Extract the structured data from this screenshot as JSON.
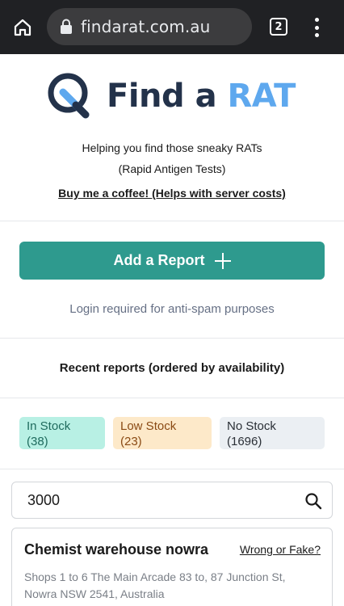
{
  "browser": {
    "url": "findarat.com.au",
    "tab_count": "2"
  },
  "header": {
    "logo_find": "Find a ",
    "logo_rat": "RAT",
    "tagline_1": "Helping you find those sneaky RATs",
    "tagline_2": "(Rapid Antigen Tests)",
    "coffee_link": "Buy me a coffee! (Helps with server costs)"
  },
  "actions": {
    "add_report_label": "Add a Report",
    "login_note": "Login required for anti-spam purposes"
  },
  "recent": {
    "title": "Recent reports (ordered by availability)",
    "badges": [
      {
        "label": "In Stock",
        "count": "(38)"
      },
      {
        "label": "Low Stock",
        "count": "(23)"
      },
      {
        "label": "No Stock",
        "count": "(1696)"
      }
    ]
  },
  "search": {
    "value": "3000"
  },
  "results": [
    {
      "name": "Chemist warehouse nowra",
      "flag_link": "Wrong or Fake?",
      "address_line_1": "Shops 1 to 6 The Main Arcade 83 to, 87 Junction St,",
      "address_line_2": "Nowra NSW 2541, Australia"
    }
  ],
  "colors": {
    "brand_dark": "#23324a",
    "brand_light": "#5ea8ee",
    "accent_button": "#2e9a8e",
    "in_stock_bg": "#b8f0e4",
    "low_stock_bg": "#fde9c9",
    "no_stock_bg": "#ebeff3"
  },
  "icons": {
    "home": "home-icon",
    "lock": "lock-icon",
    "tabs": "tabs-icon",
    "menu": "more-vert-icon",
    "logo": "magnifier-logo-icon",
    "plus": "plus-icon",
    "search": "search-icon"
  }
}
